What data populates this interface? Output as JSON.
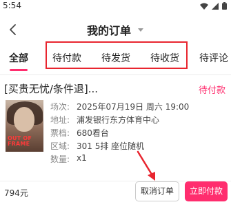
{
  "status_bar": {
    "time": "5:54",
    "icons": [
      "wifi-icon",
      "signal-icon",
      "battery-icon"
    ]
  },
  "header": {
    "back_icon": "chevron-left-icon",
    "title": "我的订单",
    "title_icon": "caret-down-icon"
  },
  "tabs": [
    {
      "label": "全部",
      "active": true
    },
    {
      "label": "待付款",
      "active": false
    },
    {
      "label": "待发货",
      "active": false
    },
    {
      "label": "待收货",
      "active": false
    },
    {
      "label": "待评论",
      "active": false
    }
  ],
  "order": {
    "name": "[买贵无忧/条件退]...",
    "status": "待付款",
    "poster_text": [
      "OUT OF",
      "FRAME"
    ],
    "details": [
      {
        "label": "场次:",
        "value": "2025年07月19日 周六 19:00"
      },
      {
        "label": "地址:",
        "value": "浦发银行东方体育中心"
      },
      {
        "label": "票档:",
        "value": "680看台"
      },
      {
        "label": "区域:",
        "value": "301 5排 座位随机"
      },
      {
        "label": "数量:",
        "value": "x1"
      }
    ],
    "price": "794元",
    "cancel_label": "取消订单",
    "pay_label": "立即付款"
  },
  "colors": {
    "accent": "#ff2d6e",
    "highlight_box": "#e8252f"
  }
}
